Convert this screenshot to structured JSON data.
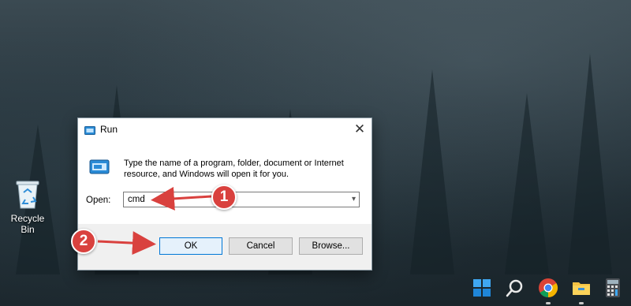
{
  "desktop": {
    "icons": [
      {
        "label": "Recycle Bin",
        "icon": "recycle-bin-icon"
      }
    ]
  },
  "run_dialog": {
    "title": "Run",
    "description": "Type the name of a program, folder, document or Internet resource, and Windows will open it for you.",
    "open_label": "Open:",
    "open_value": "cmd",
    "buttons": {
      "ok": "OK",
      "cancel": "Cancel",
      "browse": "Browse..."
    }
  },
  "annotations": [
    {
      "number": "1",
      "points_to": "open-input"
    },
    {
      "number": "2",
      "points_to": "ok-button"
    }
  ],
  "taskbar": {
    "icons": [
      "windows-start-icon",
      "search-icon",
      "chrome-icon",
      "file-explorer-icon",
      "calculator-icon"
    ]
  },
  "colors": {
    "annotation": "#d9413e",
    "accent": "#0078d7"
  }
}
